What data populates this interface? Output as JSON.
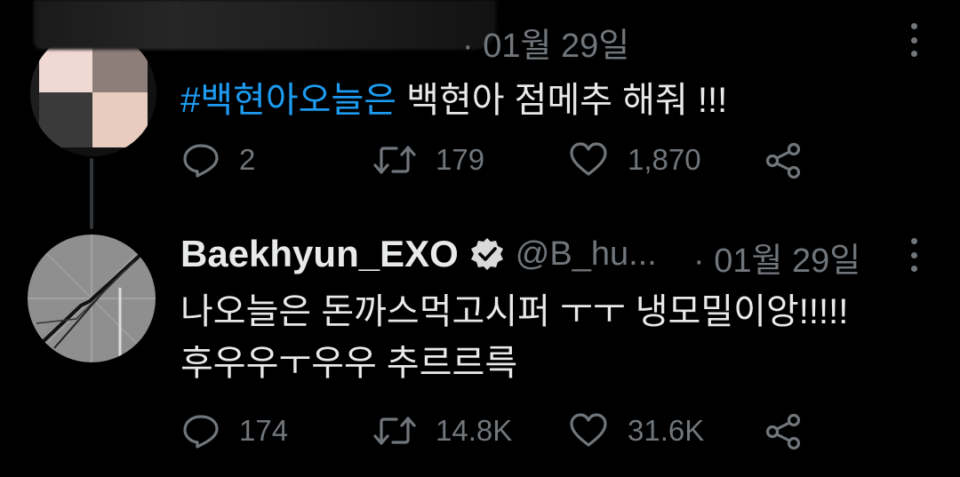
{
  "colors": {
    "background": "#000000",
    "text": "#e7e9ea",
    "muted": "#71767b",
    "link": "#1d9bf0",
    "thread_line": "#333639"
  },
  "tweet1": {
    "meta": "· 01월 29일",
    "hashtag": "#백현아오늘은",
    "body": " 백현아 점메추 해줘 !!!",
    "replies": "2",
    "retweets": "179",
    "likes": "1,870"
  },
  "tweet2": {
    "name": "Baekhyun_EXO",
    "handle": "@B_hu...",
    "meta": "· 01월 29일",
    "line1": "나오늘은 돈까스먹고시퍼 ㅜㅜ 냉모밀이앙!!!!!",
    "line2": "후우우ㅜ우우 추르르륵",
    "replies": "174",
    "retweets": "14.8K",
    "likes": "31.6K"
  },
  "icons": {
    "reply": "reply-icon",
    "retweet": "retweet-icon",
    "like": "like-icon",
    "share": "share-icon",
    "more": "more-icon",
    "verified": "verified-badge-icon"
  }
}
